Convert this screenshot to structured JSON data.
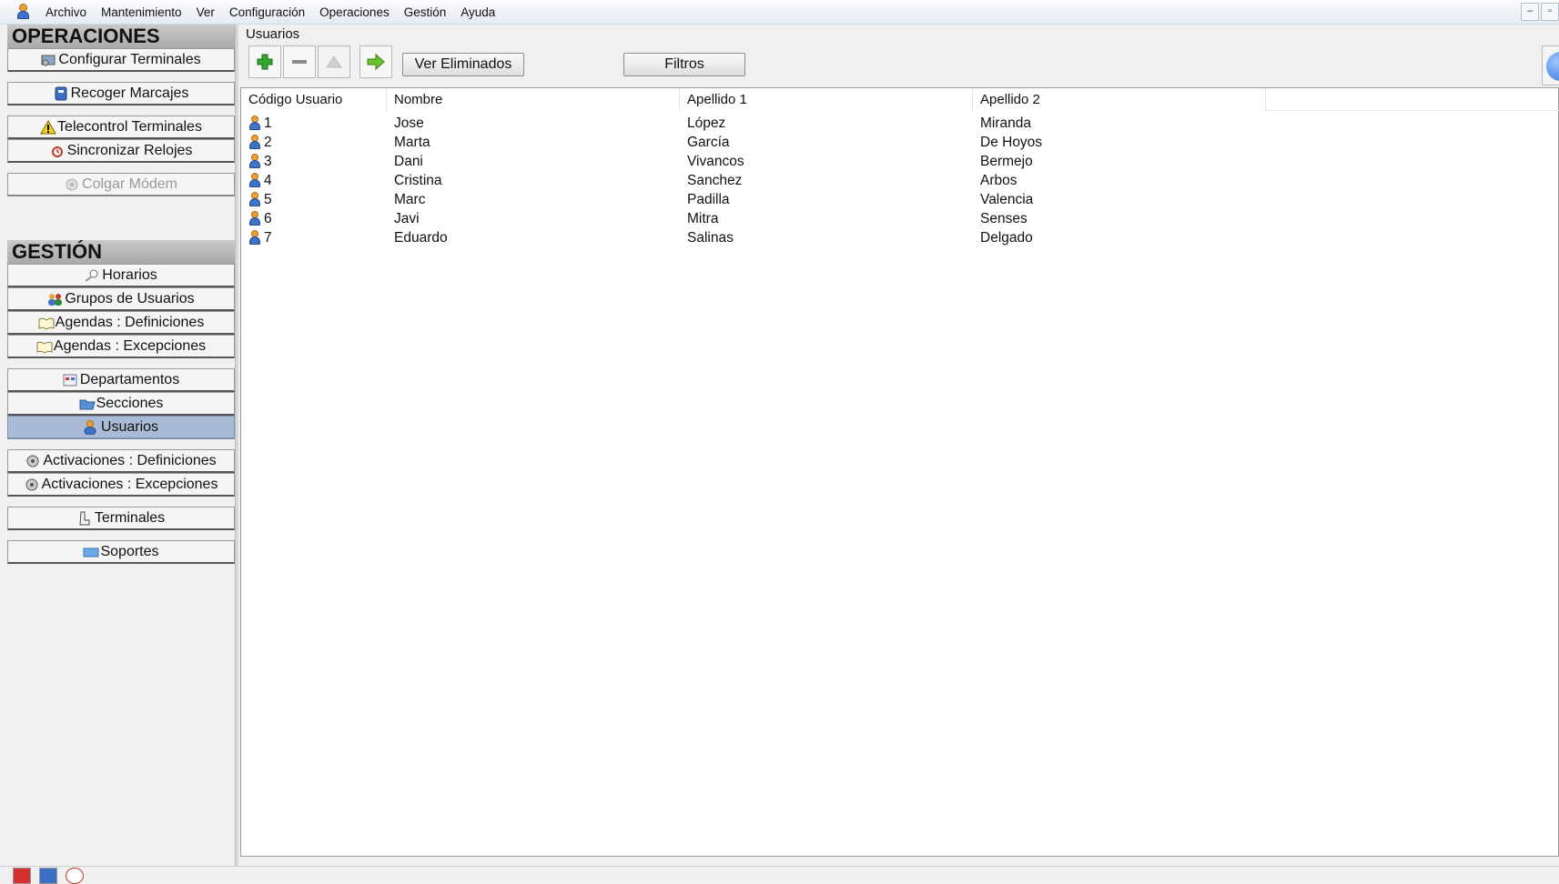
{
  "menubar": {
    "items": [
      "Archivo",
      "Mantenimiento",
      "Ver",
      "Configuración",
      "Operaciones",
      "Gestión",
      "Ayuda"
    ]
  },
  "sidebar": {
    "operaciones_header": "OPERACIONES",
    "gestion_header": "GESTIÓN",
    "operaciones": [
      {
        "label": "Configurar Terminales",
        "icon": "terminal-config-icon"
      },
      {
        "label": "Recoger Marcajes",
        "icon": "collect-icon"
      },
      {
        "label": "Telecontrol Terminales",
        "icon": "warning-icon"
      },
      {
        "label": "Sincronizar Relojes",
        "icon": "sync-clock-icon"
      },
      {
        "label": "Colgar Módem",
        "icon": "modem-icon",
        "disabled": true
      }
    ],
    "gestion": [
      {
        "label": "Horarios",
        "icon": "schedule-icon"
      },
      {
        "label": "Grupos de Usuarios",
        "icon": "user-groups-icon"
      },
      {
        "label": "Agendas : Definiciones",
        "icon": "agenda-icon"
      },
      {
        "label": "Agendas : Excepciones",
        "icon": "agenda-icon"
      },
      {
        "label": "Departamentos",
        "icon": "department-icon"
      },
      {
        "label": "Secciones",
        "icon": "sections-icon"
      },
      {
        "label": "Usuarios",
        "icon": "user-icon",
        "selected": true
      },
      {
        "label": "Activaciones : Definiciones",
        "icon": "activation-icon"
      },
      {
        "label": "Activaciones : Excepciones",
        "icon": "activation-icon"
      },
      {
        "label": "Terminales",
        "icon": "terminal-icon"
      },
      {
        "label": "Soportes",
        "icon": "card-icon"
      }
    ]
  },
  "panel": {
    "title": "Usuarios",
    "ver_eliminados": "Ver Eliminados",
    "filtros": "Filtros"
  },
  "grid": {
    "columns": [
      "Código Usuario",
      "Nombre",
      "Apellido 1",
      "Apellido 2"
    ],
    "rows": [
      {
        "codigo": "1",
        "nombre": "Jose",
        "apellido1": "López",
        "apellido2": "Miranda"
      },
      {
        "codigo": "2",
        "nombre": "Marta",
        "apellido1": "García",
        "apellido2": "De Hoyos"
      },
      {
        "codigo": "3",
        "nombre": "Dani",
        "apellido1": "Vivancos",
        "apellido2": "Bermejo"
      },
      {
        "codigo": "4",
        "nombre": "Cristina",
        "apellido1": "Sanchez",
        "apellido2": "Arbos"
      },
      {
        "codigo": "5",
        "nombre": "Marc",
        "apellido1": "Padilla",
        "apellido2": "Valencia"
      },
      {
        "codigo": "6",
        "nombre": "Javi",
        "apellido1": "Mitra",
        "apellido2": "Senses"
      },
      {
        "codigo": "7",
        "nombre": "Eduardo",
        "apellido1": "Salinas",
        "apellido2": "Delgado"
      }
    ]
  },
  "colors": {
    "selected_bg": "#a9bbd6",
    "add_green": "#2fa82f",
    "arrow_green": "#6cc22a"
  }
}
